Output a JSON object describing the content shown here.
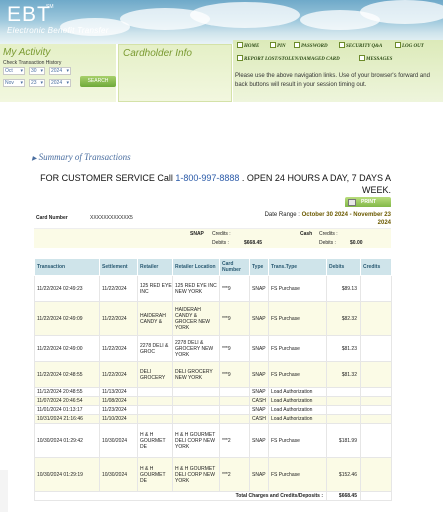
{
  "header": {
    "logo": "EBT",
    "logo_sm": "SM",
    "subtitle": "Electronic Benefit Transfer"
  },
  "activity": {
    "title": "My Activity",
    "subtitle": "Check Transaction History",
    "from_month": "Oct",
    "from_day": "30",
    "from_year": "2024",
    "to_month": "Nov",
    "to_day": "23",
    "to_year": "2024",
    "search_label": "SEARCH"
  },
  "cardholder": {
    "title": "Cardholder Info"
  },
  "nav": {
    "items": [
      {
        "label": "HOME"
      },
      {
        "label": "PIN"
      },
      {
        "label": "PASSWORD"
      },
      {
        "label": "SECURITY Q&A"
      },
      {
        "label": "LOG OUT"
      },
      {
        "label": "REPORT LOST/STOLEN/DAMAGED CARD"
      },
      {
        "label": "MESSAGES"
      }
    ],
    "note": "Please use the above navigation links. Use of your browser's forward and back buttons will result in your session timing out."
  },
  "print_label": "PRINT",
  "summary": {
    "title": "Summary of Transactions",
    "cs_prefix": "FOR CUSTOMER SERVICE Call ",
    "cs_phone": "1-800-997-8888",
    "cs_suffix": " . OPEN 24 HOURS A DAY, 7 DAYS A WEEK.",
    "card_label": "Card Number",
    "card_value": "XXXXXXXXXXXX5",
    "date_label": "Date Range : ",
    "date_value_1": "October 30 2024 -  November 23",
    "date_value_2": "2024"
  },
  "balances": {
    "snap_label": "SNAP",
    "snap_credits_label": "Credits :",
    "snap_credits_value": "",
    "snap_debits_label": "Debits :",
    "snap_debits_value": "$668.45",
    "cash_label": "Cash",
    "cash_credits_label": "Credits :",
    "cash_credits_value": "",
    "cash_debits_label": "Debits :",
    "cash_debits_value": "$0.00"
  },
  "table": {
    "headers": [
      "Transaction",
      "Settlement",
      "Retailer",
      "Retailer Location",
      "Card Number",
      "Type",
      "Trans.Type",
      "Debits",
      "Credits"
    ],
    "rows": [
      [
        "11/22/2024 02:49:23",
        "11/22/2024",
        "125 RED EYE INC",
        "125 RED EYE INC NEW YORK",
        "***9",
        "SNAP",
        "FS Purchase",
        "$89.13",
        ""
      ],
      [
        "11/22/2024 02:49:09",
        "11/22/2024",
        "HAIDERAH CANDY &",
        "HAIDERAH CANDY & GROCER NEW YORK",
        "***9",
        "SNAP",
        "FS Purchase",
        "$82.32",
        ""
      ],
      [
        "11/22/2024 02:49:00",
        "11/22/2024",
        "2278 DELI & GROC",
        "2278 DELI & GROCERY NEW YORK",
        "***9",
        "SNAP",
        "FS Purchase",
        "$81.23",
        ""
      ],
      [
        "11/22/2024 02:48:55",
        "11/22/2024",
        "DELI GROCERY",
        "DELI GROCERY NEW YORK",
        "***9",
        "SNAP",
        "FS Purchase",
        "$81.32",
        ""
      ],
      [
        "11/12/2024 20:48:55",
        "11/13/2024",
        "",
        "",
        "",
        "SNAP",
        "Load Authorization",
        "",
        ""
      ],
      [
        "11/07/2024 20:46:54",
        "11/08/2024",
        "",
        "",
        "",
        "CASH",
        "Load Authorization",
        "",
        ""
      ],
      [
        "11/01/2024 01:13:17",
        "11/23/2024",
        "",
        "",
        "",
        "SNAP",
        "Load Authorization",
        "",
        ""
      ],
      [
        "10/31/2024 21:16:46",
        "11/10/2024",
        "",
        "",
        "",
        "CASH",
        "Load Authorization",
        "",
        ""
      ],
      [
        "10/30/2024 01:29:42",
        "10/30/2024",
        "H & H GOURMET DE",
        "H & H GOURMET DELI CORP NEW YORK",
        "***2",
        "SNAP",
        "FS Purchase",
        "$181.99",
        ""
      ],
      [
        "10/30/2024 01:29:19",
        "10/30/2024",
        "H & H GOURMET DE",
        "H & H GOURMET DELI CORP NEW YORK",
        "***2",
        "SNAP",
        "FS Purchase",
        "$152.46",
        ""
      ]
    ],
    "total_label": "Total Charges and Credits/Deposits :",
    "total_debits": "$668.45",
    "total_credits": ""
  }
}
